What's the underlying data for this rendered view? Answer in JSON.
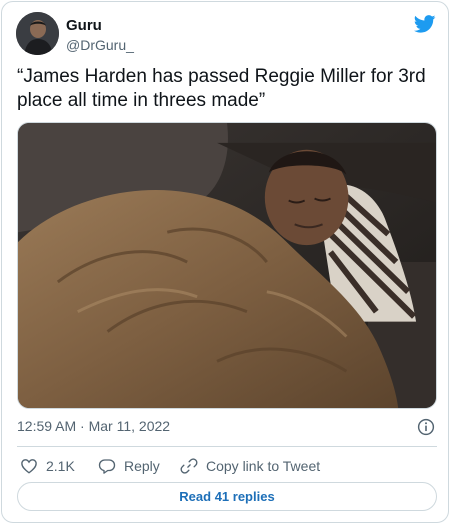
{
  "author": {
    "name": "Guru",
    "handle": "@DrGuru_",
    "avatar_icon": "profile-photo"
  },
  "brand": {
    "icon": "twitter-bird-icon",
    "color": "#1d9bf0"
  },
  "tweet": {
    "text": "“James Harden has passed Reggie Miller for 3rd place all time in threes made”",
    "media_icon": "photo-man-sleeping-under-blanket",
    "timestamp": "12:59 AM · Mar 11, 2022"
  },
  "actions": {
    "like_count": "2.1K",
    "reply_label": "Reply",
    "copy_label": "Copy link to Tweet"
  },
  "replies": {
    "label": "Read 41 replies"
  },
  "colors": {
    "text_primary": "#0f1419",
    "text_secondary": "#536471",
    "border": "#cfd9de",
    "link": "#1d6fb8"
  }
}
